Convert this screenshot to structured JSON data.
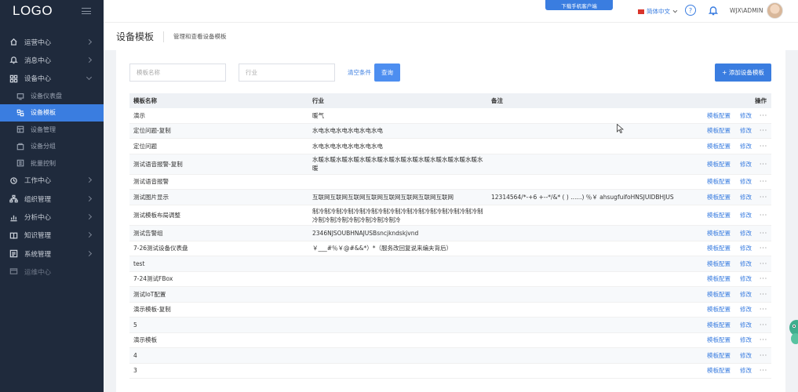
{
  "app": {
    "logo": "LOGO",
    "download_label": "下载手机客户端",
    "language": "简体中文",
    "help_glyph": "?",
    "username": "WJX\\ADMIN"
  },
  "sidebar": {
    "items": [
      {
        "label": "运营中心",
        "icon": "monitor-icon"
      },
      {
        "label": "消息中心",
        "icon": "bell-icon"
      },
      {
        "label": "设备中心",
        "icon": "grid-icon"
      },
      {
        "label": "工作中心",
        "icon": "wrench-icon"
      },
      {
        "label": "组织管理",
        "icon": "org-icon"
      },
      {
        "label": "分析中心",
        "icon": "chart-icon"
      },
      {
        "label": "知识管理",
        "icon": "book-icon"
      },
      {
        "label": "系统管理",
        "icon": "settings-icon"
      },
      {
        "label": "运维中心",
        "icon": "tools-icon"
      }
    ],
    "subitems": [
      {
        "label": "设备仪表盘"
      },
      {
        "label": "设备模板"
      },
      {
        "label": "设备管理"
      },
      {
        "label": "设备分组"
      },
      {
        "label": "批量控制"
      }
    ]
  },
  "page": {
    "title": "设备模板",
    "subtitle": "管理和查看设备模板"
  },
  "filters": {
    "name_placeholder": "模板名称",
    "industry_placeholder": "行业",
    "clear_label": "清空条件",
    "search_label": "查询",
    "add_label": "+ 添加设备模板"
  },
  "table": {
    "headers": {
      "name": "模板名称",
      "industry": "行业",
      "note": "备注",
      "ops": "操作"
    },
    "op_config": "模板配置",
    "op_edit": "修改",
    "op_more": "···",
    "rows": [
      {
        "name": "演示",
        "industry": "暖气",
        "note": ""
      },
      {
        "name": "定位问题-复制",
        "industry": "水电水电水电水电水电水电",
        "note": ""
      },
      {
        "name": "定位问题",
        "industry": "水电水电水电水电水电水电",
        "note": ""
      },
      {
        "name": "测试语音报警-复制",
        "industry": "水暖水暖水暖水暖水暖水暖水暖水暖水暖水暖水暖水暖水暖水暖水暖",
        "note": ""
      },
      {
        "name": "测试语音报警",
        "industry": "",
        "note": ""
      },
      {
        "name": "测试图片显示",
        "industry": "互联网互联网互联网互联网互联网互联网互联网互联网",
        "note": "12314564/*-+6 +--*/&* ( ) ......) ％￥ ahsugfuifoHNSJUIDBHJUS"
      },
      {
        "name": "测试模板布局调整",
        "industry": "制冷制冷制冷制冷制冷制冷制冷制冷制冷制冷制冷制冷制冷制冷制冷制冷制冷制冷制冷制冷制冷制冷",
        "note": ""
      },
      {
        "name": "测试告警组",
        "industry": "2346NJSOUBHNAJUSBsncjkndskjvnd",
        "note": ""
      },
      {
        "name": "7-26测试设备仪表盘",
        "industry": "￥___#％￥@#&&*）*（服务改回复说来编夫背后）",
        "note": ""
      },
      {
        "name": "test",
        "industry": "",
        "note": ""
      },
      {
        "name": "7-24测试FBox",
        "industry": "",
        "note": ""
      },
      {
        "name": "测试IoT配置",
        "industry": "",
        "note": ""
      },
      {
        "name": "演示模板-复制",
        "industry": "",
        "note": ""
      },
      {
        "name": "5",
        "industry": "",
        "note": ""
      },
      {
        "name": "演示模板",
        "industry": "",
        "note": ""
      },
      {
        "name": "4",
        "industry": "",
        "note": ""
      },
      {
        "name": "3",
        "industry": "",
        "note": ""
      }
    ]
  },
  "colors": {
    "sidebar_bg": "#1f2a3c",
    "accent": "#3a7de0"
  }
}
